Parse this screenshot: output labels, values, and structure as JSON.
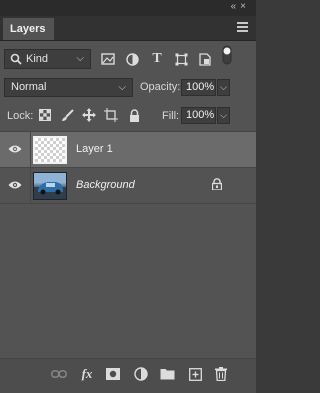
{
  "panel": {
    "tab_label": "Layers"
  },
  "filter": {
    "kind_label": "Kind"
  },
  "blend": {
    "mode": "Normal",
    "opacity_label": "Opacity:",
    "opacity_value": "100%"
  },
  "lock": {
    "label": "Lock:",
    "fill_label": "Fill:",
    "fill_value": "100%"
  },
  "layers": [
    {
      "name": "Layer 1",
      "selected": true,
      "thumbnail": "transparent-checker"
    },
    {
      "name": "Background",
      "selected": false,
      "thumbnail": "photo",
      "locked": true
    }
  ],
  "bottom_bar": {
    "fx_label": "fx"
  },
  "colors": {
    "panel_bg": "#535353",
    "selected_row": "#6b6b6b",
    "text": "#f0f0f0"
  }
}
